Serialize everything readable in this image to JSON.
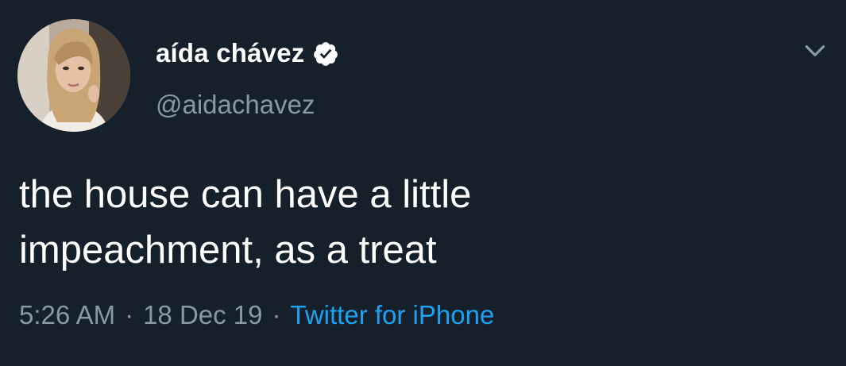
{
  "user": {
    "display_name": "aída chávez",
    "handle": "@aidachavez",
    "verified": true
  },
  "tweet": {
    "text": "the house can have a little\nimpeachment, as a treat",
    "time": "5:26 AM",
    "separator": "·",
    "date": "18 Dec 19",
    "source": "Twitter for iPhone"
  },
  "colors": {
    "background": "#15202b",
    "primary_text": "#ffffff",
    "secondary_text": "#8899a6",
    "link": "#1da1f2"
  },
  "icons": {
    "verified": "verified-badge-icon",
    "menu": "chevron-down-icon"
  }
}
